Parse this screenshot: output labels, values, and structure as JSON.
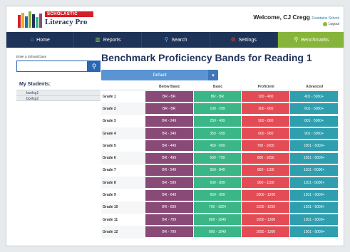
{
  "header": {
    "brand_publisher": "SCHOLASTIC",
    "brand_name": "Literacy Pro",
    "welcome": "Welcome, CJ Cregg",
    "school": "Fountains School",
    "logout": "Logout"
  },
  "nav": {
    "items": [
      {
        "label": "Home",
        "icon": "home-icon"
      },
      {
        "label": "Reports",
        "icon": "bar-chart-icon"
      },
      {
        "label": "Search",
        "icon": "search-icon"
      },
      {
        "label": "Settings",
        "icon": "gear-icon"
      },
      {
        "label": "Benchmarks",
        "icon": "person-icon",
        "active": true
      }
    ]
  },
  "sidebar": {
    "enter_label": "Enter a School/Class",
    "search_value": "",
    "students_heading": "My Students:",
    "students": [
      "bcelxg1",
      "bcelxg2"
    ]
  },
  "main": {
    "title": "Benchmark Proficiency Bands for Reading 1",
    "dropdown_value": "Default",
    "columns": [
      "Below Basic",
      "Basic",
      "Proficient",
      "Advanced"
    ],
    "rows": [
      {
        "grade": "Grade 1",
        "below": "BR - BR",
        "basic": "BR - BR",
        "prof": "100 - 400",
        "adv": "401 - 5000+"
      },
      {
        "grade": "Grade 2",
        "below": "BR - BR",
        "basic": "100 - 299",
        "prof": "300 - 600",
        "adv": "601 - 5000+"
      },
      {
        "grade": "Grade 3",
        "below": "BR - 249",
        "basic": "250 - 499",
        "prof": "500 - 800",
        "adv": "801 - 5000+"
      },
      {
        "grade": "Grade 4",
        "below": "BR - 349",
        "basic": "350 - 599",
        "prof": "600 - 900",
        "adv": "901 - 5000+"
      },
      {
        "grade": "Grade 5",
        "below": "BR - 449",
        "basic": "450 - 699",
        "prof": "700 - 1000",
        "adv": "1001 - 5000+"
      },
      {
        "grade": "Grade 6",
        "below": "BR - 499",
        "basic": "500 - 799",
        "prof": "800 - 1050",
        "adv": "1051 - 5000+"
      },
      {
        "grade": "Grade 7",
        "below": "BR - 549",
        "basic": "550 - 849",
        "prof": "850 - 1100",
        "adv": "1101 - 5000+"
      },
      {
        "grade": "Grade 8",
        "below": "BR - 599",
        "basic": "600 - 899",
        "prof": "900 - 1150",
        "adv": "1151 - 5000+"
      },
      {
        "grade": "Grade 9",
        "below": "BR - 649",
        "basic": "650 - 999",
        "prof": "1000 - 1200",
        "adv": "1201 - 5000+"
      },
      {
        "grade": "Grade 10",
        "below": "BR - 699",
        "basic": "700 - 1024",
        "prof": "1025 - 1250",
        "adv": "1251 - 5000+"
      },
      {
        "grade": "Grade 11",
        "below": "BR - 799",
        "basic": "800 - 1049",
        "prof": "1050 - 1300",
        "adv": "1301 - 5000+"
      },
      {
        "grade": "Grade 12",
        "below": "BR - 799",
        "basic": "800 - 1049",
        "prof": "1050 - 1300",
        "adv": "1301 - 5000+"
      }
    ]
  },
  "colors": {
    "nav_bg": "#1e3358",
    "nav_active": "#87b43a",
    "below_basic": "#8a4a78",
    "basic": "#3bb687",
    "proficient": "#e44c55",
    "advanced": "#2f9fb0"
  }
}
